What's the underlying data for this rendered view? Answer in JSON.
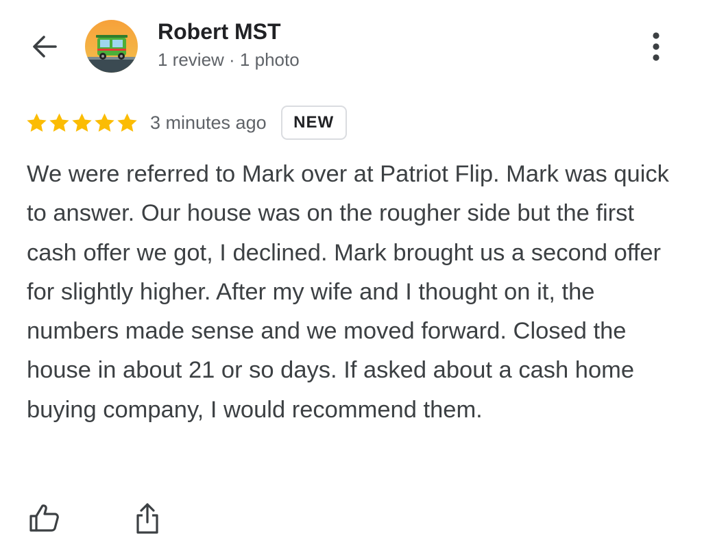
{
  "header": {
    "user_name": "Robert MST",
    "user_meta": "1 review · 1 photo",
    "back_icon": "arrow-back-icon",
    "more_icon": "more-vert-icon"
  },
  "review": {
    "rating": 5,
    "rating_max": 5,
    "time_ago": "3 minutes ago",
    "badge": "NEW",
    "text": "We were referred to Mark over at Patriot Flip. Mark was quick to answer. Our house was on the rougher side but the first cash offer we got, I declined. Mark brought us a second offer for slightly higher. After my wife and I thought on it, the numbers made sense and we moved forward. Closed the house in about 21 or so days. If asked about a cash home buying company, I would recommend them."
  },
  "actions": {
    "like_icon": "thumbs-up-icon",
    "share_icon": "share-icon"
  },
  "colors": {
    "star": "#fbbc04",
    "text_primary": "#202124",
    "text_secondary": "#5f6368",
    "review_text": "#3c4043",
    "badge_border": "#dadce0"
  }
}
